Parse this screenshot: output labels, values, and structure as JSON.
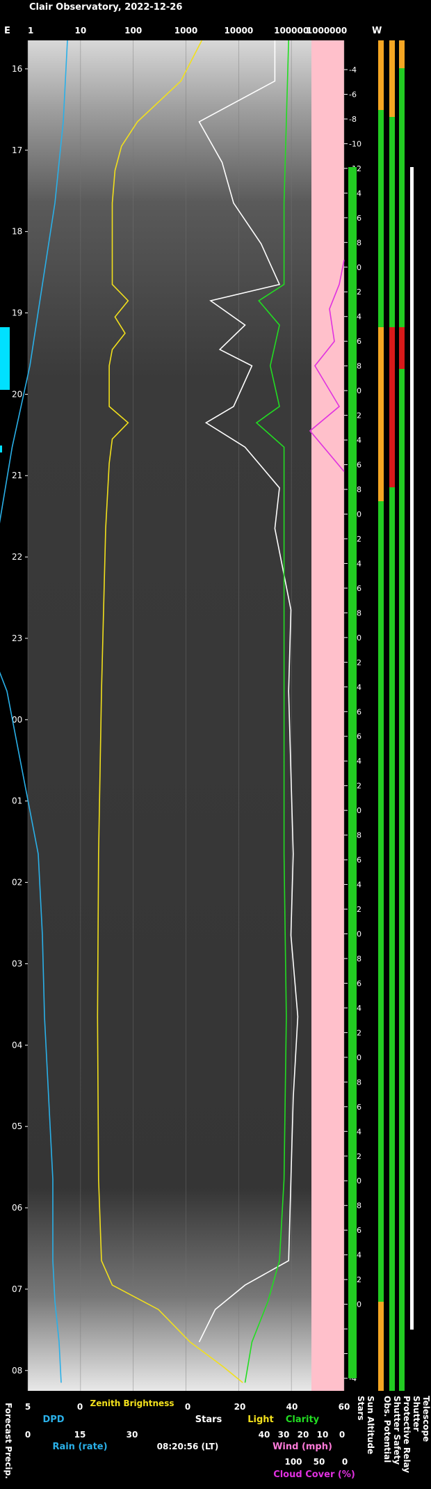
{
  "header": {
    "title": "Clair Observatory, 2022-12-26",
    "east": "E",
    "west": "W"
  },
  "chart_data": {
    "type": "line",
    "top_axis": {
      "scale": "log",
      "ticks": [
        "1",
        "10",
        "100",
        "1000",
        "10000",
        "100000",
        "1000000"
      ]
    },
    "time_ticks": [
      "16",
      "17",
      "18",
      "19",
      "20",
      "21",
      "22",
      "23",
      "00",
      "01",
      "02",
      "03",
      "04",
      "05",
      "06",
      "07",
      "08"
    ],
    "sun_altitude_ticks": [
      "-4",
      "-6",
      "-8",
      "-10",
      "-12",
      "-14",
      "-16",
      "-18",
      "-20",
      "-22",
      "-24",
      "-26",
      "-28",
      "-30",
      "-32",
      "-34",
      "-36",
      "-38",
      "-40",
      "-42",
      "-44",
      "-46",
      "-48",
      "-50",
      "-52",
      "-54",
      "-56",
      "-56",
      "-54",
      "-52",
      "-50",
      "-48",
      "-46",
      "-44",
      "-42",
      "-40",
      "-38",
      "-36",
      "-34",
      "-32",
      "-30",
      "-28",
      "-26",
      "-24",
      "-22",
      "-20",
      "-18",
      "-16",
      "-14",
      "-12",
      "-10",
      "-8",
      "-6",
      "-4"
    ],
    "series": [
      {
        "name": "DPD",
        "color": "#2ab0e8",
        "x_hours": [
          0,
          1,
          2,
          3,
          3.5,
          4,
          5,
          6,
          7,
          7.5,
          8,
          9,
          10,
          11,
          12,
          13,
          14,
          15,
          15.5,
          16,
          16.5
        ],
        "values": [
          1.2,
          1.6,
          2.4,
          3.6,
          4.2,
          4.8,
          6.5,
          7.8,
          9.2,
          8.5,
          7.0,
          5.5,
          4.0,
          3.6,
          3.4,
          3.0,
          2.6,
          2.6,
          2.4,
          2.0,
          1.8
        ]
      },
      {
        "name": "Zenith Brightness",
        "color": "#f2e01c",
        "x_hours": [
          0,
          0.5,
          1,
          1.3,
          1.6,
          2,
          3,
          3.2,
          3.4,
          3.6,
          3.8,
          4,
          4.5,
          4.7,
          4.9,
          5.2,
          6,
          8,
          10,
          12,
          14,
          15,
          15.3,
          15.6,
          16,
          16.3,
          16.5
        ],
        "values": [
          2000,
          800,
          120,
          60,
          45,
          40,
          40,
          80,
          45,
          70,
          40,
          35,
          35,
          80,
          40,
          35,
          30,
          25,
          22,
          21,
          22,
          25,
          40,
          300,
          1200,
          5000,
          12000
        ]
      },
      {
        "name": "Stars",
        "color": "#ffffff",
        "x_hours": [
          0,
          0.5,
          1,
          1.5,
          2,
          2.5,
          3,
          3.2,
          3.5,
          3.8,
          4,
          4.5,
          4.7,
          5,
          5.5,
          6,
          7,
          8,
          9,
          10,
          11,
          12,
          13,
          14,
          15,
          15.3,
          15.6,
          16
        ],
        "values": [
          38,
          38,
          5,
          15,
          20,
          32,
          40,
          10,
          25,
          14,
          28,
          20,
          8,
          25,
          40,
          38,
          45,
          44,
          45,
          46,
          45,
          48,
          46,
          45,
          44,
          25,
          12,
          5
        ]
      },
      {
        "name": "Clarity",
        "color": "#22dd22",
        "x_hours": [
          0,
          1,
          2,
          3,
          3.2,
          3.5,
          4,
          4.5,
          4.7,
          5,
          6,
          8,
          10,
          12,
          14,
          15,
          15.5,
          16,
          16.5
        ],
        "values": [
          44,
          43,
          42,
          42,
          31,
          40,
          36,
          40,
          30,
          42,
          42,
          42,
          42,
          43,
          42,
          40,
          35,
          28,
          25
        ]
      },
      {
        "name": "Cloud Cover",
        "color": "#e030e0",
        "x_hours": [
          2.7,
          3,
          3.3,
          3.7,
          4,
          4.5,
          4.8,
          5.3
        ],
        "values": [
          0,
          10,
          30,
          20,
          60,
          10,
          70,
          0
        ]
      }
    ],
    "left_status_blocks": [
      "forecast"
    ],
    "right_columns": {
      "labels": [
        "Stars",
        "Sun Altitude",
        "Obs. Potential",
        "Shutter Safety",
        "Protective Relay",
        "Shutter",
        "Telescope"
      ]
    },
    "bottom_axes": [
      {
        "title": "DPD",
        "color": "#2ab0e8",
        "ticks": [
          "5",
          "0"
        ]
      },
      {
        "title": "Zenith Brightness",
        "color": "#f2e01c",
        "ticks": [
          "15",
          "30"
        ]
      },
      {
        "title": "Stars",
        "color": "#ffffff",
        "ticks": [
          "0",
          "20",
          "40",
          "60"
        ]
      },
      {
        "title": "Light",
        "color": "#f2e01c",
        "ticks": []
      },
      {
        "title": "Clarity",
        "color": "#22dd22",
        "ticks": []
      },
      {
        "title": "Rain (rate)",
        "color": "#2ab0e8",
        "ticks": [
          "0",
          "15",
          "30"
        ]
      },
      {
        "title": "Wind (mph)",
        "color": "#ff7ad9",
        "ticks": [
          "40",
          "30",
          "20",
          "10",
          "0"
        ]
      },
      {
        "title": "Cloud Cover (%)",
        "color": "#e030e0",
        "ticks": [
          "100",
          "50",
          "0"
        ]
      }
    ],
    "timestamp": "08:20:56 (LT)",
    "forecast_label": "Forecast Precip."
  }
}
